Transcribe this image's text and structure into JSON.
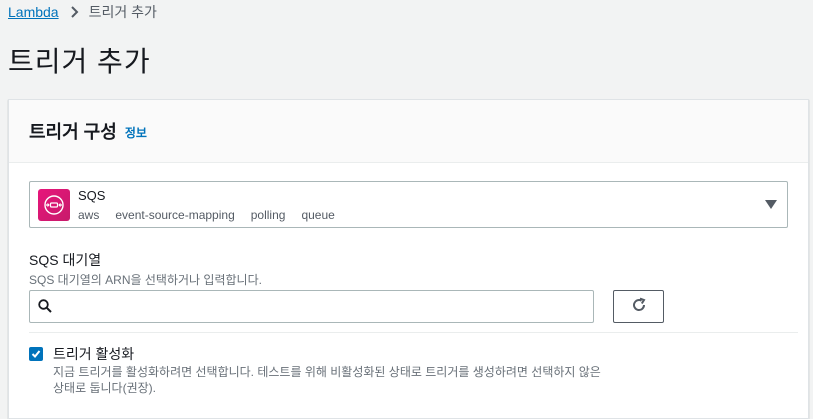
{
  "breadcrumb": {
    "root": "Lambda",
    "current": "트리거 추가"
  },
  "page": {
    "title": "트리거 추가"
  },
  "panel": {
    "title": "트리거 구성",
    "info_link": "정보"
  },
  "source": {
    "icon": "sqs-icon",
    "name": "SQS",
    "tags": [
      "aws",
      "event-source-mapping",
      "polling",
      "queue"
    ]
  },
  "queue_field": {
    "label": "SQS 대기열",
    "description": "SQS 대기열의 ARN을 선택하거나 입력합니다.",
    "value": "",
    "placeholder": ""
  },
  "enable_trigger": {
    "label": "트리거 활성화",
    "checked": true,
    "description": "지금 트리거를 활성화하려면 선택합니다. 테스트를 위해 비활성화된 상태로 트리거를 생성하려면 선택하지 않은 상태로 둡니다(권장)."
  },
  "colors": {
    "accent": "#0073bb",
    "sqs_brand": "#e7157b",
    "background": "#f2f3f3"
  }
}
